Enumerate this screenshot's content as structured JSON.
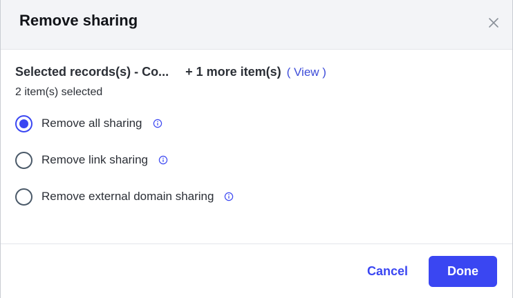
{
  "dialog": {
    "title": "Remove sharing",
    "close_icon": "close-icon"
  },
  "records": {
    "selected_name": "Selected records(s) - Co...",
    "more_items": "+ 1 more item(s)",
    "view_link": "( View )",
    "count_text": "2 item(s) selected"
  },
  "options": [
    {
      "label": "Remove all sharing",
      "checked": true,
      "icon": "info-icon"
    },
    {
      "label": "Remove link sharing",
      "checked": false,
      "icon": "info-icon"
    },
    {
      "label": "Remove external domain sharing",
      "checked": false,
      "icon": "info-icon"
    }
  ],
  "footer": {
    "cancel_label": "Cancel",
    "done_label": "Done"
  },
  "colors": {
    "accent": "#3a46f2",
    "header_bg": "#f3f4f7",
    "text": "#2b2f36"
  }
}
